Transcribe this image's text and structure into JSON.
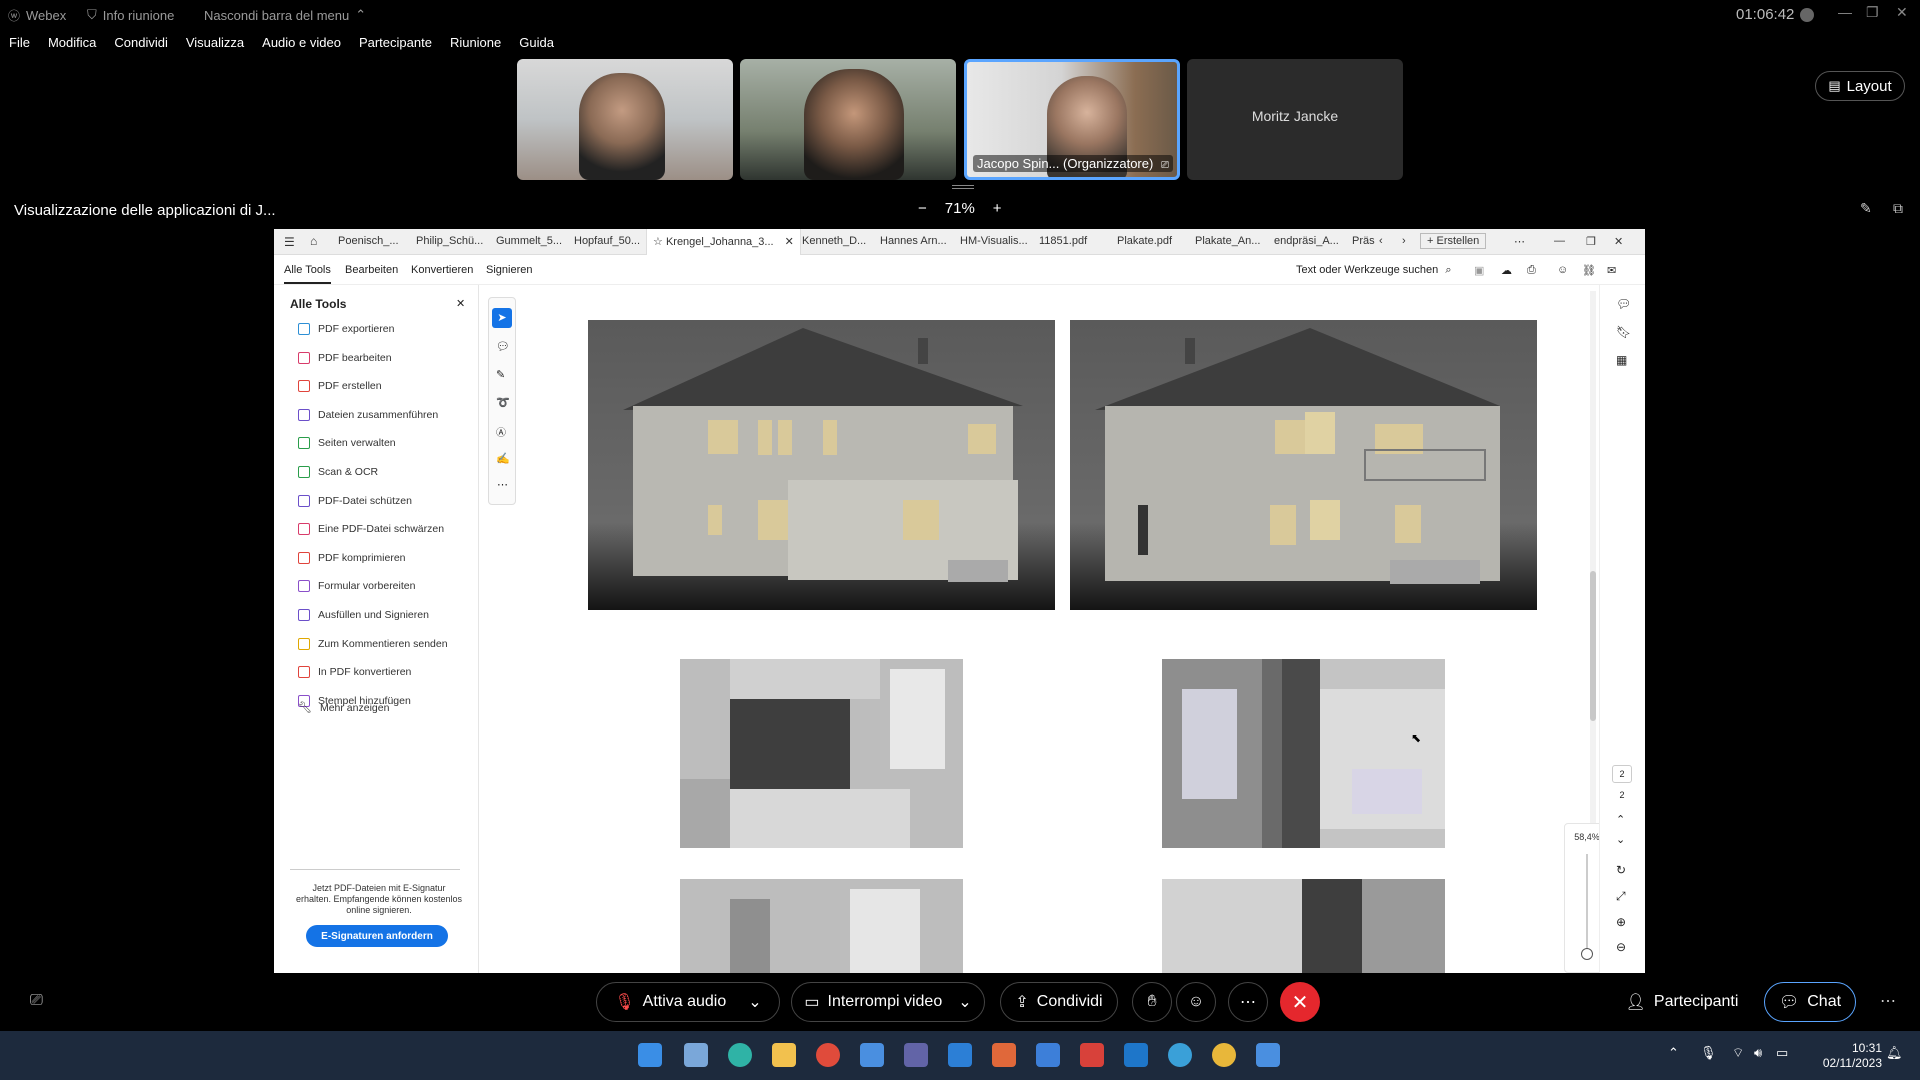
{
  "titlebar": {
    "app": "Webex",
    "info": "Info riunione",
    "hide_menu": "Nascondi barra del menu",
    "time": "01:06:42"
  },
  "menu": [
    "File",
    "Modifica",
    "Condividi",
    "Visualizza",
    "Audio e video",
    "Partecipante",
    "Riunione",
    "Guida"
  ],
  "participants": {
    "active_label": "Jacopo Spin... (Organizzatore)",
    "named_tile": "Moritz Jancke"
  },
  "layout_label": "Layout",
  "share_title": "Visualizzazione delle applicazioni di J...",
  "zoom": {
    "minus": "−",
    "value": "71%",
    "plus": "+"
  },
  "acrobat": {
    "tabs": [
      "Poenisch_...",
      "Philip_Schü...",
      "Gummelt_5...",
      "Hopfauf_50...",
      "Krengel_Johanna_3...",
      "Kenneth_D...",
      "Hannes Arn...",
      "HM-Visualis...",
      "11851.pdf",
      "Plakate.pdf",
      "Plakate_An...",
      "endpräsi_A...",
      "Präs"
    ],
    "create": "Erstellen",
    "toolbar_tabs": [
      "Alle Tools",
      "Bearbeiten",
      "Konvertieren",
      "Signieren"
    ],
    "search": "Text oder Werkzeuge suchen",
    "panel_title": "Alle Tools",
    "tools": [
      {
        "label": "PDF exportieren",
        "color": "#2d8fd5"
      },
      {
        "label": "PDF bearbeiten",
        "color": "#d83b6a"
      },
      {
        "label": "PDF erstellen",
        "color": "#e0443c"
      },
      {
        "label": "Dateien zusammenführen",
        "color": "#6b4fc9"
      },
      {
        "label": "Seiten verwalten",
        "color": "#2a9d4a"
      },
      {
        "label": "Scan & OCR",
        "color": "#2a9d4a"
      },
      {
        "label": "PDF-Datei schützen",
        "color": "#6b4fc9"
      },
      {
        "label": "Eine PDF-Datei schwärzen",
        "color": "#d83b6a"
      },
      {
        "label": "PDF komprimieren",
        "color": "#e0443c"
      },
      {
        "label": "Formular vorbereiten",
        "color": "#8a4fc9"
      },
      {
        "label": "Ausfüllen und Signieren",
        "color": "#6b4fc9"
      },
      {
        "label": "Zum Kommentieren senden",
        "color": "#e0a800"
      },
      {
        "label": "In PDF konvertieren",
        "color": "#e0443c"
      },
      {
        "label": "Stempel hinzufügen",
        "color": "#8a4fc9"
      }
    ],
    "more": "Mehr anzeigen",
    "esig_note": "Jetzt PDF-Dateien mit E-Signatur erhalten. Empfangende können kostenlos online signieren.",
    "esig_button": "E-Signaturen anfordern",
    "page_num": "2",
    "page_total": "2",
    "doc_zoom": "58,4%"
  },
  "controls": {
    "audio": "Attiva audio",
    "video": "Interrompi video",
    "share": "Condividi",
    "participants": "Partecipanti",
    "chat": "Chat"
  },
  "taskbar": {
    "time": "10:31",
    "date": "02/11/2023"
  }
}
